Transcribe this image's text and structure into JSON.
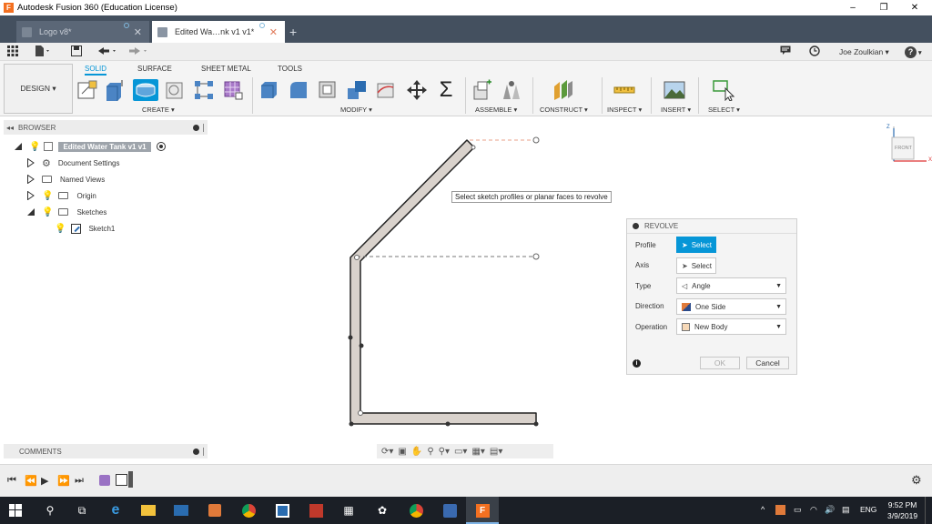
{
  "window": {
    "title": "Autodesk Fusion 360 (Education License)",
    "controls": [
      "–",
      "❐",
      "✕"
    ]
  },
  "tabs": [
    {
      "label": "Logo v8*",
      "active": false
    },
    {
      "label": "Edited Wa…nk v1 v1*",
      "active": true
    }
  ],
  "toolbar": {
    "user": "Joe Zoulkian ▾",
    "help": "?"
  },
  "ribbon": {
    "workspace": "DESIGN ▾",
    "tabs": [
      "SOLID",
      "SURFACE",
      "SHEET METAL",
      "TOOLS"
    ],
    "active_tab": "SOLID",
    "groups": [
      "CREATE ▾",
      "MODIFY ▾",
      "ASSEMBLE ▾",
      "CONSTRUCT ▾",
      "INSPECT ▾",
      "INSERT ▾",
      "SELECT ▾"
    ],
    "sum_symbol": "Σ"
  },
  "browser": {
    "title": "BROWSER",
    "root": "Edited Water Tank v1 v1",
    "items": [
      {
        "label": "Document Settings"
      },
      {
        "label": "Named Views"
      },
      {
        "label": "Origin"
      },
      {
        "label": "Sketches"
      },
      {
        "label": "Sketch1"
      }
    ]
  },
  "comments": {
    "title": "COMMENTS"
  },
  "viewport": {
    "tooltip": "Select sketch profiles or planar faces to revolve",
    "viewcube_label": "FRONT",
    "axis_z": "Z",
    "axis_x": "X"
  },
  "revolve": {
    "title": "REVOLVE",
    "rows": [
      {
        "label": "Profile",
        "value": "Select"
      },
      {
        "label": "Axis",
        "value": "Select"
      },
      {
        "label": "Type",
        "value": "Angle"
      },
      {
        "label": "Direction",
        "value": "One Side"
      },
      {
        "label": "Operation",
        "value": "New Body"
      }
    ],
    "ok": "OK",
    "cancel": "Cancel"
  },
  "taskbar": {
    "lang": "ENG",
    "time": "9:52 PM",
    "date": "3/9/2019"
  },
  "colors": {
    "accent": "#0696d7",
    "tabbar": "#44505f",
    "sketch_fill": "#d9d2cc",
    "taskbar": "#1b1f26"
  }
}
